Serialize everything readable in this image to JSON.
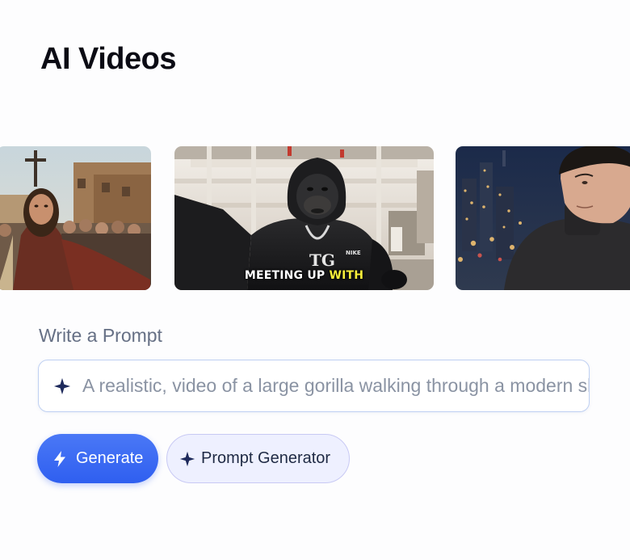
{
  "page": {
    "title": "AI Videos"
  },
  "carousel": {
    "items": [
      {
        "name": "video-thumbnail-jesus",
        "caption_main": "",
        "caption_highlight": ""
      },
      {
        "name": "video-thumbnail-gorilla",
        "caption_main": "MEETING UP ",
        "caption_highlight": "WITH",
        "shirt_text": "TG",
        "shirt_logo": "NIKE"
      },
      {
        "name": "video-thumbnail-man-city",
        "caption_main": "",
        "caption_highlight": ""
      }
    ]
  },
  "prompt": {
    "label": "Write a Prompt",
    "value": "A realistic, video of a large gorilla walking through a modern shopping mall",
    "icon": "sparkle-icon"
  },
  "actions": {
    "generate_label": "Generate",
    "generate_icon": "lightning-icon",
    "prompt_generator_label": "Prompt Generator",
    "prompt_generator_icon": "sparkle-icon"
  },
  "colors": {
    "accent": "#2f5ff0",
    "accent_light": "#eef0ff",
    "sparkle": "#1e2a5c",
    "caption_highlight": "#f7ee3a"
  }
}
